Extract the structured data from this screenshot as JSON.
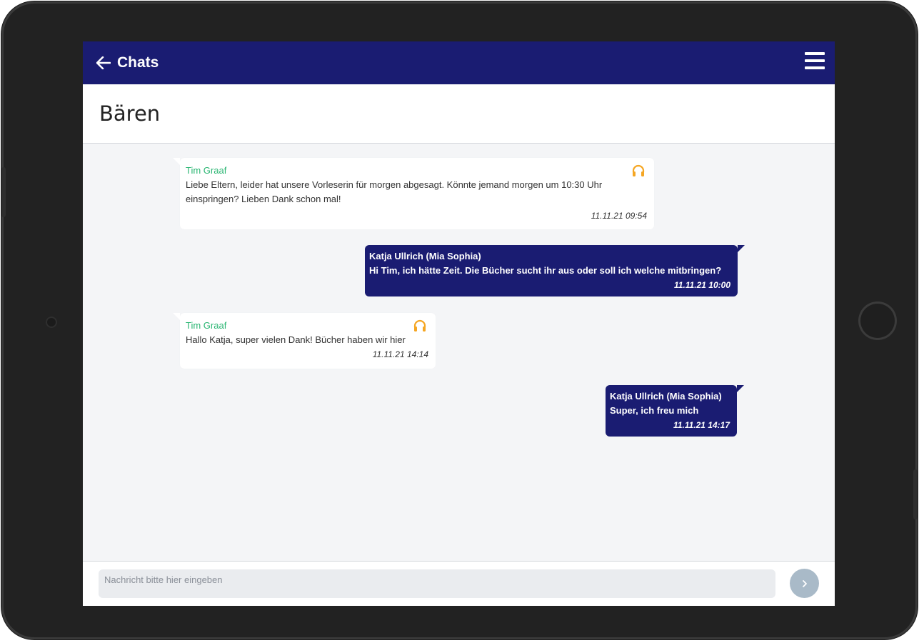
{
  "header": {
    "back_label": "Chats",
    "menu_icon": "hamburger-menu-icon"
  },
  "group": {
    "title": "Bären"
  },
  "messages": [
    {
      "direction": "incoming",
      "sender": "Tim Graaf",
      "text": "Liebe Eltern, leider hat unsere Vorleserin für morgen abgesagt. Könnte jemand morgen um 10:30 Uhr einspringen? Lieben Dank schon mal!",
      "time": "11.11.21 09:54",
      "icon": "headset-icon"
    },
    {
      "direction": "outgoing",
      "sender": "Katja Ullrich (Mia Sophia)",
      "text": "Hi Tim, ich hätte Zeit. Die Bücher sucht ihr aus oder soll ich welche mitbringen?",
      "time": "11.11.21 10:00"
    },
    {
      "direction": "incoming",
      "sender": "Tim Graaf",
      "text": "Hallo Katja, super vielen Dank! Bücher haben wir hier",
      "time": "11.11.21 14:14",
      "icon": "headset-icon"
    },
    {
      "direction": "outgoing",
      "sender": "Katja Ullrich (Mia Sophia)",
      "text": "Super, ich freu mich",
      "time": "11.11.21 14:17"
    }
  ],
  "composer": {
    "placeholder": "Nachricht bitte hier eingeben",
    "value": "",
    "send_icon": "chevron-right-icon"
  },
  "colors": {
    "primary": "#1a1c72",
    "sender_incoming": "#2bb673",
    "headset": "#f5a623",
    "background": "#f4f5f7",
    "send_button": "#a9bac8"
  }
}
